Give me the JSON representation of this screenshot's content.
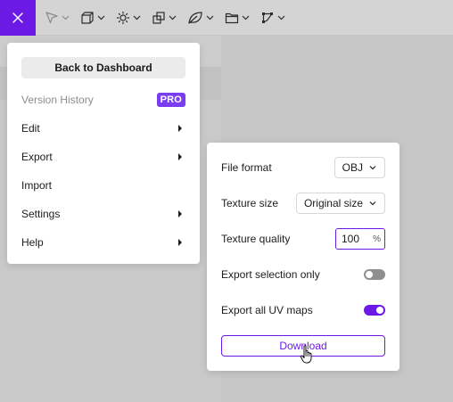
{
  "colors": {
    "accent": "#6c19e6",
    "pro_badge": "#7a3df0",
    "toggle_off": "#8f8f8f"
  },
  "toolbar": {
    "close_icon": "close-icon",
    "tools": [
      {
        "name": "select-tool",
        "icon": "cursor-arrow-icon"
      },
      {
        "name": "shapes-tool",
        "icon": "cube-icon"
      },
      {
        "name": "light-tool",
        "icon": "sun-icon"
      },
      {
        "name": "objects-tool",
        "icon": "boolean-shapes-icon"
      },
      {
        "name": "material-tool",
        "icon": "leaf-icon"
      },
      {
        "name": "folder-tool",
        "icon": "folder-icon"
      },
      {
        "name": "nodes-tool",
        "icon": "node-graph-icon"
      }
    ]
  },
  "menu": {
    "back_label": "Back to Dashboard",
    "version_history": "Version History",
    "pro_badge": "PRO",
    "edit": "Edit",
    "export": "Export",
    "import": "Import",
    "settings": "Settings",
    "help": "Help"
  },
  "export": {
    "file_format_label": "File format",
    "file_format_value": "OBJ",
    "texture_size_label": "Texture size",
    "texture_size_value": "Original size",
    "texture_quality_label": "Texture quality",
    "texture_quality_value": "100",
    "texture_quality_unit": "%",
    "selection_only_label": "Export selection only",
    "selection_only_enabled": false,
    "uv_maps_label": "Export all UV maps",
    "uv_maps_enabled": true,
    "download_label": "Download"
  }
}
